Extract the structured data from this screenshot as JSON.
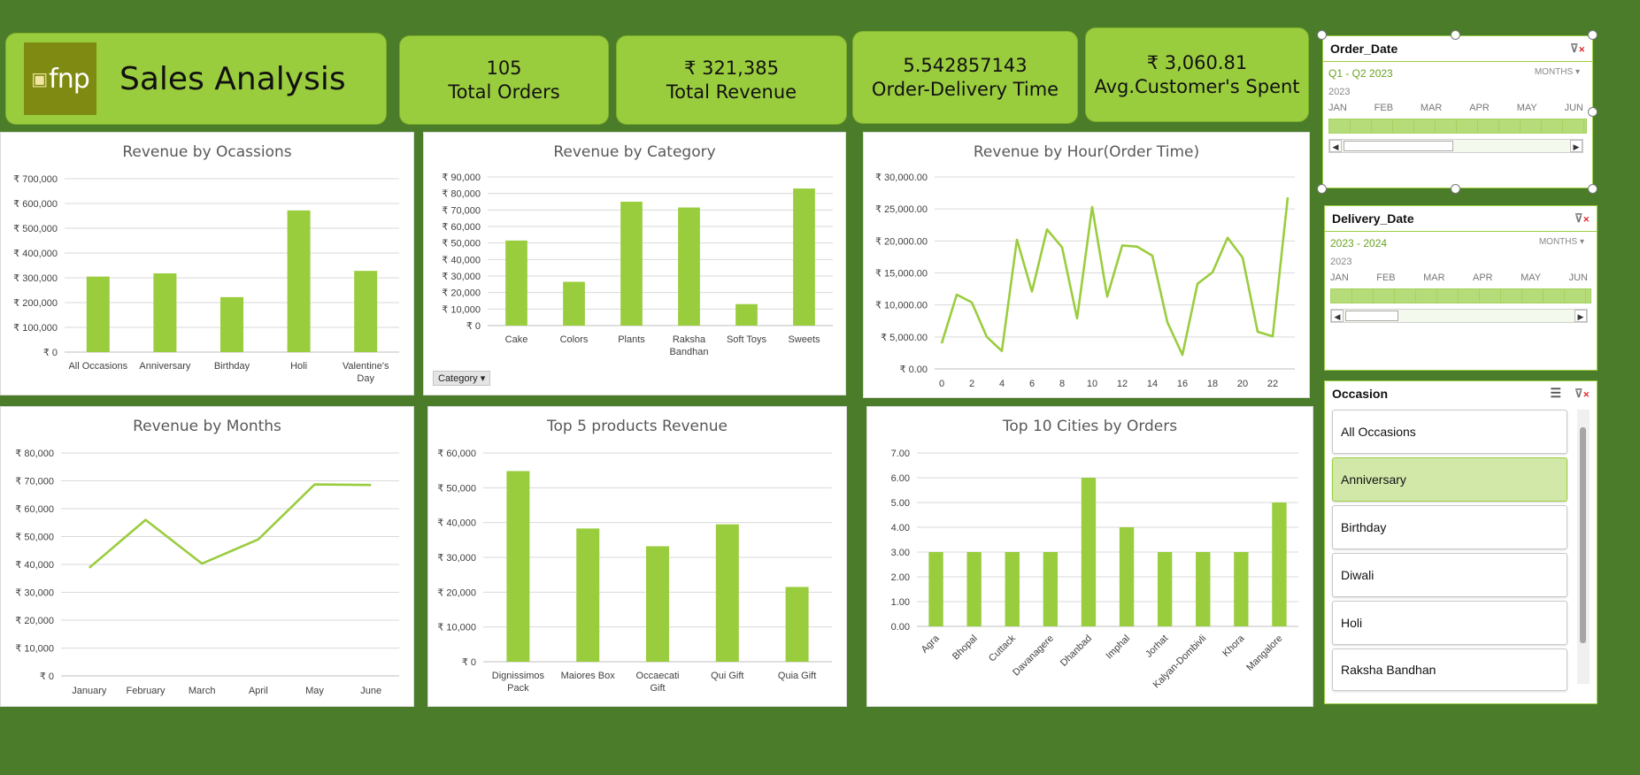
{
  "header": {
    "logo_text": "fnp",
    "title": "Sales Analysis"
  },
  "kpis": [
    {
      "value": "105",
      "label": "Total Orders"
    },
    {
      "value": "₹ 321,385",
      "label": "Total Revenue"
    },
    {
      "value": "5.542857143",
      "label": "Order-Delivery Time"
    },
    {
      "value": "₹ 3,060.81",
      "label": "Avg.Customer's Spent"
    }
  ],
  "colors": {
    "accent": "#9acd3e",
    "background": "#4a7c2a",
    "bar": "#9acd3e",
    "line": "#9acd3e",
    "gridline": "#d9d9d9"
  },
  "order_date_slicer": {
    "title": "Order_Date",
    "range": "Q1 - Q2 2023",
    "level": "MONTHS",
    "year": "2023",
    "months": [
      "JAN",
      "FEB",
      "MAR",
      "APR",
      "MAY",
      "JUN"
    ],
    "filter_icon": "clear-filter-icon"
  },
  "delivery_date_slicer": {
    "title": "Delivery_Date",
    "range": "2023 - 2024",
    "level": "MONTHS",
    "year": "2023",
    "months": [
      "JAN",
      "FEB",
      "MAR",
      "APR",
      "MAY",
      "JUN"
    ],
    "filter_icon": "clear-filter-icon"
  },
  "occasion_slicer": {
    "title": "Occasion",
    "items": [
      "All Occasions",
      "Anniversary",
      "Birthday",
      "Diwali",
      "Holi",
      "Raksha Bandhan"
    ],
    "selected": "Anniversary"
  },
  "category_filter_button": "Category",
  "chart_data": [
    {
      "id": "occasions",
      "type": "bar",
      "title": "Revenue by Ocassions",
      "categories": [
        "All Occasions",
        "Anniversary",
        "Birthday",
        "Holi",
        "Valentine's Day"
      ],
      "values": [
        305000,
        318000,
        222000,
        572000,
        328000
      ],
      "ylim": [
        0,
        700000
      ],
      "ticks": [
        "₹ 0",
        "₹ 100,000",
        "₹ 200,000",
        "₹ 300,000",
        "₹ 400,000",
        "₹ 500,000",
        "₹ 600,000",
        "₹ 700,000"
      ],
      "grid": true
    },
    {
      "id": "category",
      "type": "bar",
      "title": "Revenue by Category",
      "categories": [
        "Cake",
        "Colors",
        "Plants",
        "Raksha Bandhan",
        "Soft Toys",
        "Sweets"
      ],
      "values": [
        51500,
        26500,
        75000,
        71500,
        13000,
        83000
      ],
      "ylim": [
        0,
        90000
      ],
      "ticks": [
        "₹ 0",
        "₹ 10,000",
        "₹ 20,000",
        "₹ 30,000",
        "₹ 40,000",
        "₹ 50,000",
        "₹ 60,000",
        "₹ 70,000",
        "₹ 80,000",
        "₹ 90,000"
      ],
      "grid": true
    },
    {
      "id": "hour",
      "type": "line",
      "title": "Revenue by Hour(Order Time)",
      "x": [
        0,
        1,
        2,
        3,
        4,
        5,
        6,
        7,
        8,
        9,
        10,
        11,
        12,
        13,
        14,
        15,
        16,
        17,
        18,
        19,
        20,
        21,
        22,
        23
      ],
      "values": [
        4000,
        11600,
        10400,
        5000,
        2800,
        20200,
        12100,
        21800,
        19000,
        7900,
        25300,
        11300,
        19300,
        19100,
        17700,
        7300,
        2200,
        13300,
        15100,
        20500,
        17400,
        5800,
        5100,
        26800
      ],
      "xticks": [
        "0",
        "2",
        "4",
        "6",
        "8",
        "10",
        "12",
        "14",
        "16",
        "18",
        "20",
        "22"
      ],
      "ylim": [
        0,
        30000
      ],
      "ticks": [
        "₹ 0.00",
        "₹ 5,000.00",
        "₹ 10,000.00",
        "₹ 15,000.00",
        "₹ 20,000.00",
        "₹ 25,000.00",
        "₹ 30,000.00"
      ],
      "grid": true
    },
    {
      "id": "months",
      "type": "line",
      "title": "Revenue by Months",
      "categories": [
        "January",
        "February",
        "March",
        "April",
        "May",
        "June"
      ],
      "values": [
        38800,
        56000,
        40300,
        49000,
        68700,
        68500
      ],
      "ylim": [
        0,
        80000
      ],
      "ticks": [
        "₹ 0",
        "₹ 10,000",
        "₹ 20,000",
        "₹ 30,000",
        "₹ 40,000",
        "₹ 50,000",
        "₹ 60,000",
        "₹ 70,000",
        "₹ 80,000"
      ],
      "grid": true
    },
    {
      "id": "products",
      "type": "bar",
      "title": "Top 5 products Revenue",
      "categories": [
        "Dignissimos Pack",
        "Maiores Box",
        "Occaecati Gift",
        "Qui Gift",
        "Quia Gift"
      ],
      "values": [
        54800,
        38300,
        33200,
        39500,
        21500
      ],
      "ylim": [
        0,
        60000
      ],
      "ticks": [
        "₹ 0",
        "₹ 10,000",
        "₹ 20,000",
        "₹ 30,000",
        "₹ 40,000",
        "₹ 50,000",
        "₹ 60,000"
      ],
      "grid": true
    },
    {
      "id": "cities",
      "type": "bar",
      "title": "Top 10 Cities by Orders",
      "categories": [
        "Agra",
        "Bhopal",
        "Cuttack",
        "Davanagere",
        "Dhanbad",
        "Imphal",
        "Jorhat",
        "Kalyan-Dombivli",
        "Khora",
        "Mangalore"
      ],
      "values": [
        3,
        3,
        3,
        3,
        6,
        4,
        3,
        3,
        3,
        5
      ],
      "ylim": [
        0,
        7
      ],
      "ticks": [
        "0.00",
        "1.00",
        "2.00",
        "3.00",
        "4.00",
        "5.00",
        "6.00",
        "7.00"
      ],
      "grid": true
    }
  ]
}
